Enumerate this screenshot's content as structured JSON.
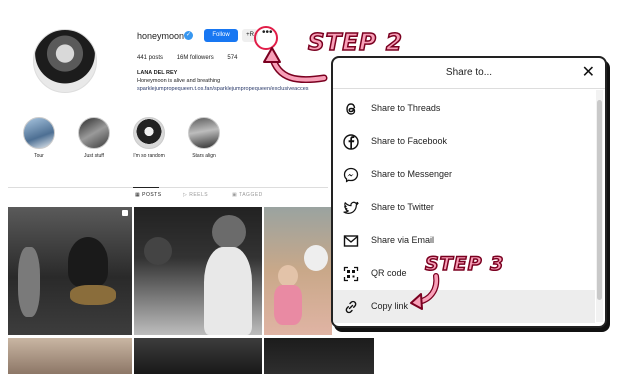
{
  "profile": {
    "username": "honeymoon",
    "follow_label": "Follow",
    "adduser_label": "+R",
    "more_label": "•••",
    "posts": "441 posts",
    "followers": "16M followers",
    "following": "574",
    "full_name": "LANA DEL REY",
    "bio": "Honeymoon is alive and breathing",
    "link": "sparklejumpropequeen.t.os.fan/sparklejumpropequeen/exclusiveacces"
  },
  "highlights": [
    {
      "label": "Tour"
    },
    {
      "label": "Just stuff"
    },
    {
      "label": "I'm so random"
    },
    {
      "label": "Stars align"
    }
  ],
  "tabs": {
    "posts": "POSTS",
    "reels": "REELS",
    "tagged": "TAGGED"
  },
  "annotations": {
    "step2": "STEP 2",
    "step3": "STEP 3"
  },
  "modal": {
    "title": "Share to...",
    "close": "✕",
    "items": [
      {
        "label": "Share to Threads",
        "icon": "threads-icon"
      },
      {
        "label": "Share to Facebook",
        "icon": "facebook-icon"
      },
      {
        "label": "Share to Messenger",
        "icon": "messenger-icon"
      },
      {
        "label": "Share to Twitter",
        "icon": "twitter-icon"
      },
      {
        "label": "Share via Email",
        "icon": "email-icon"
      },
      {
        "label": "QR code",
        "icon": "qr-code-icon"
      },
      {
        "label": "Copy link",
        "icon": "link-icon"
      }
    ]
  },
  "colors": {
    "follow": "#1877f2",
    "annotation_fill": "#f8a0b8",
    "annotation_stroke": "#7a0020",
    "verified": "#3897f0"
  }
}
